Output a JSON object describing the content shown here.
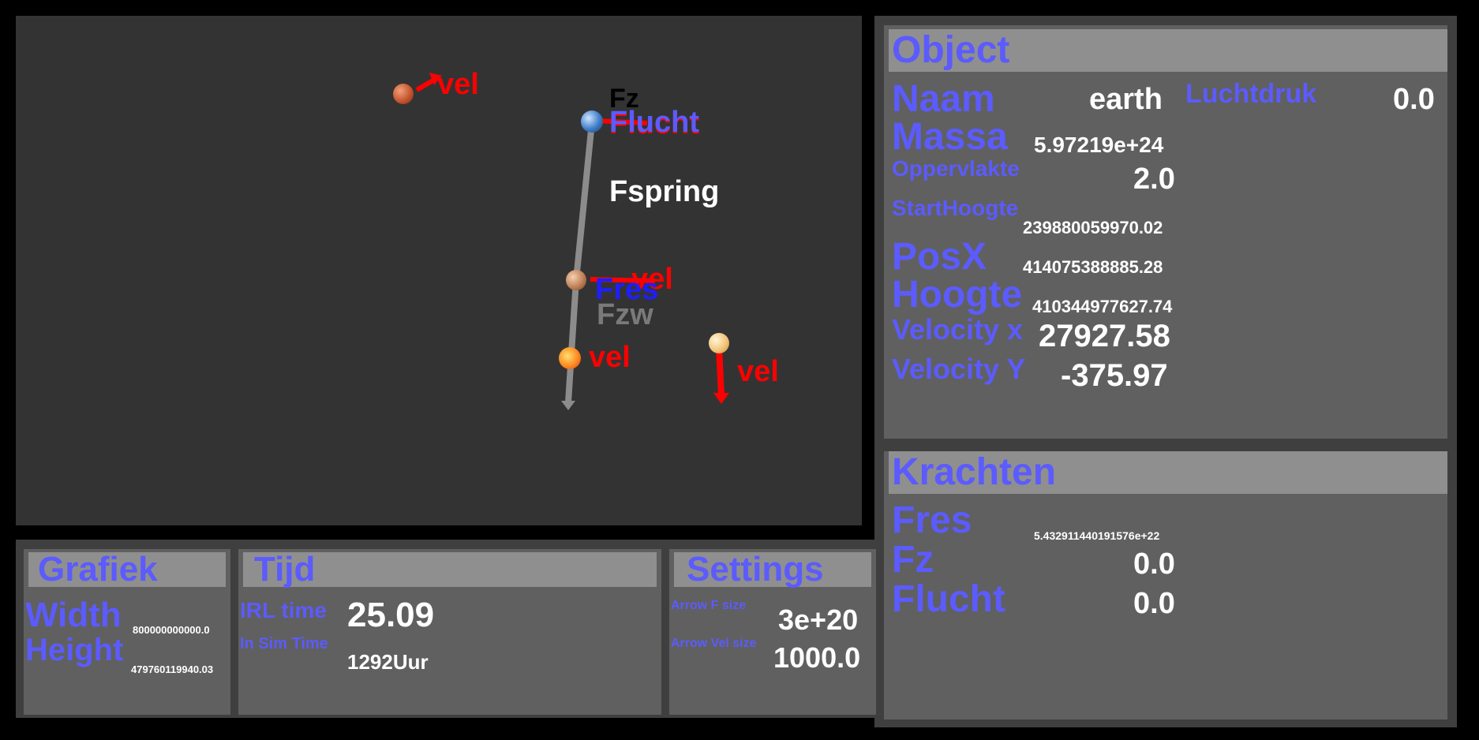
{
  "simulation": {
    "labels": {
      "vel_1": "vel",
      "fz": "Fz",
      "flucht_red": "Flucht",
      "flucht_blue": "Flucht",
      "fspring": "Fspring",
      "vel_2": "vel",
      "fres": "Fres",
      "fzw": "Fzw",
      "vel_3": "vel",
      "vel_4": "vel"
    },
    "colors": {
      "background": "#333333",
      "vel": "#ff0000",
      "fres": "#1e1eff",
      "label_blue": "#5b5bff"
    }
  },
  "object_panel": {
    "title": "Object",
    "naam_label": "Naam",
    "naam_value": "earth",
    "luchtdruk_label": "Luchtdruk",
    "luchtdruk_value": "0.0",
    "massa_label": "Massa",
    "massa_value": "5.97219e+24",
    "oppervlakte_label": "Oppervlakte",
    "oppervlakte_value": "2.0",
    "starthoogte_label": "StartHoogte",
    "starthoogte_value": "239880059970.02",
    "posx_label": "PosX",
    "posx_value": "414075388885.28",
    "hoogte_label": "Hoogte",
    "hoogte_value": "410344977627.74",
    "velx_label": "Velocity x",
    "velx_value": "27927.58",
    "vely_label": "Velocity Y",
    "vely_value": "-375.97"
  },
  "krachten_panel": {
    "title": "Krachten",
    "fres_label": "Fres",
    "fres_value": "5.432911440191576e+22",
    "fz_label": "Fz",
    "fz_value": "0.0",
    "flucht_label": "Flucht",
    "flucht_value": "0.0"
  },
  "grafiek_panel": {
    "title": "Grafiek",
    "width_label": "Width",
    "width_value": "800000000000.0",
    "height_label": "Height",
    "height_value": "479760119940.03"
  },
  "tijd_panel": {
    "title": "Tijd",
    "irl_label": "IRL time",
    "irl_value": "25.09",
    "sim_label": "In Sim Time",
    "sim_value": "1292Uur"
  },
  "settings_panel": {
    "title": "Settings",
    "arrow_f_label": "Arrow F size",
    "arrow_f_value": "3e+20",
    "arrow_vel_label": "Arrow Vel size",
    "arrow_vel_value": "1000.0"
  }
}
